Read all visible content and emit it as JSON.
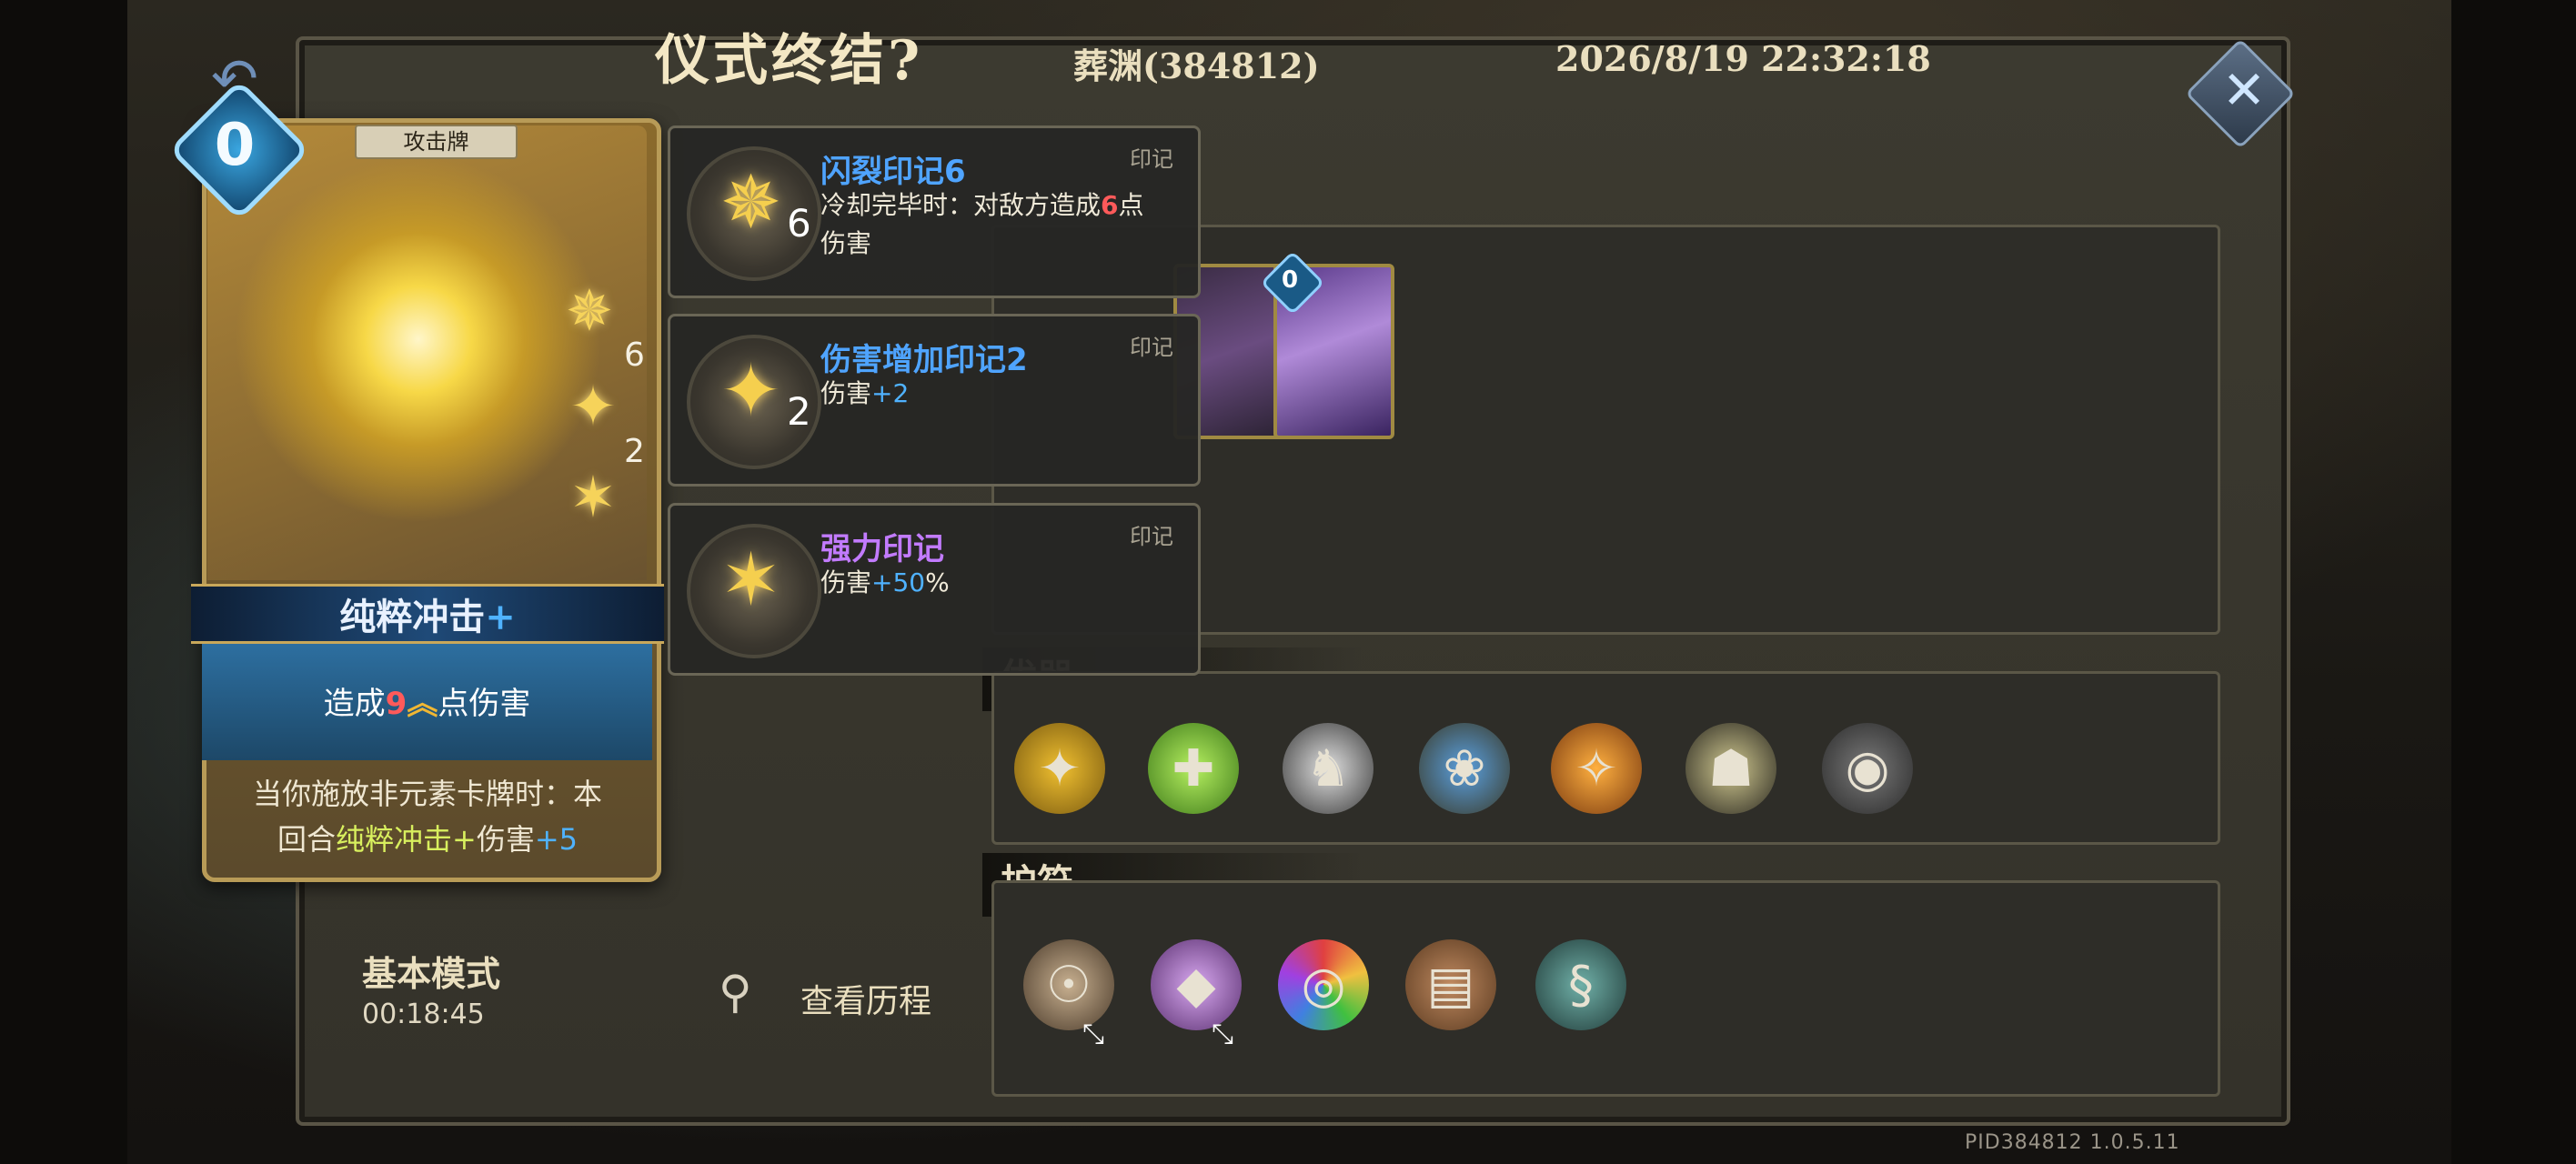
{
  "header": {
    "title": "仪式终结?",
    "player": "葬渊(384812)",
    "datetime": "2026/8/19 22:32:18",
    "close_label": "✕"
  },
  "sections": {
    "relics_label": "优器",
    "amulets_label": "护符"
  },
  "card": {
    "cost": "0",
    "type": "攻击牌",
    "name": "纯粹冲击",
    "name_suffix": "+",
    "effect_prefix": "造成",
    "effect_value": "9",
    "effect_upgrade": "︽",
    "effect_suffix": "点伤害",
    "sub_line1": "当你施放非元素卡牌时：本",
    "sub_line2_prefix": "回合",
    "sub_line2_cardname": "纯粹冲击+",
    "sub_line2_mid": "伤害",
    "sub_line2_value": "+5",
    "marks": [
      {
        "icon": "shatter-mark-icon",
        "count": "6"
      },
      {
        "icon": "damage-up-mark-icon",
        "count": "2"
      },
      {
        "icon": "power-mark-icon",
        "count": ""
      }
    ]
  },
  "tooltips": [
    {
      "icon": "shatter-mark-icon",
      "count": "6",
      "title": "闪裂印记6",
      "category": "印记",
      "desc_a": "冷却完毕时：对敌方造成",
      "desc_value": "6",
      "desc_b": "点",
      "desc_c": "伤害",
      "title_color": "#4fa4ff"
    },
    {
      "icon": "damage-up-mark-icon",
      "count": "2",
      "title": "伤害增加印记2",
      "category": "印记",
      "desc_a": "伤害",
      "desc_value": "+2",
      "title_color": "#4fa4ff"
    },
    {
      "icon": "power-mark-icon",
      "count": "",
      "title": "强力印记",
      "category": "印记",
      "desc_a": "伤害",
      "desc_value": "+50",
      "desc_b": "%",
      "title_color": "#c27bff"
    }
  ],
  "deck_cards": [
    {
      "icon": "skeleton-mirror-card-icon"
    },
    {
      "icon": "purple-lightning-card-icon",
      "cost": "0"
    }
  ],
  "relics": [
    {
      "icon": "golden-coins-relic-icon"
    },
    {
      "icon": "green-candy-relic-icon"
    },
    {
      "icon": "dark-knight-relic-icon"
    },
    {
      "icon": "blue-flower-book-relic-icon"
    },
    {
      "icon": "burning-card-relic-icon"
    },
    {
      "icon": "plague-doctor-relic-icon"
    },
    {
      "icon": "shadow-shield-warrior-relic-icon"
    }
  ],
  "amulets": [
    {
      "icon": "owl-skull-amulet-icon"
    },
    {
      "icon": "purple-crystal-amulet-icon"
    },
    {
      "icon": "rainbow-compass-amulet-icon"
    },
    {
      "icon": "leather-book-amulet-icon"
    },
    {
      "icon": "serpent-mask-amulet-icon"
    }
  ],
  "footer": {
    "mode": "基本模式",
    "elapsed": "00:18:45",
    "history_label": "查看历程",
    "pid": "PID384812  1.0.5.11"
  }
}
